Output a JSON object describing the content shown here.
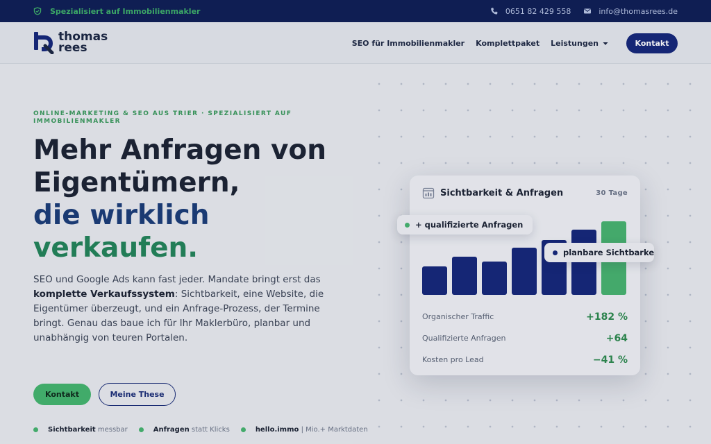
{
  "topbar": {
    "tagline": "Spezialisiert auf Immobilienmakler",
    "phone": "0651 82 429 558",
    "email": "info@thomasrees.de",
    "icons": {
      "left": "shield-check-icon",
      "phone": "phone-icon",
      "email": "mail-icon"
    }
  },
  "header": {
    "logo": {
      "line1": "thomas",
      "line2": "rees"
    },
    "nav": [
      {
        "label": "SEO für Immobilienmakler"
      },
      {
        "label": "Komplettpaket"
      },
      {
        "label": "Leistungen",
        "has_dropdown": true
      }
    ],
    "cta": "Kontakt"
  },
  "hero": {
    "kicker": "Online-Marketing & SEO aus Trier · Spezialisiert auf Immobilienmakler",
    "headline_1": "Mehr Anfragen von Eigentümern,",
    "headline_2": "die wirklich",
    "headline_3": "verkaufen.",
    "intro_1": "SEO und Google Ads kann fast jeder. Mandate bringt erst das",
    "intro_bold": "komplette Verkaufssystem",
    "intro_2": ": Sichtbarkeit, eine Website, die Eigentümer überzeugt, und ein Anfrage-Prozess, der Termine bringt. Genau das baue ich für Ihr Maklerbüro, planbar und unabhängig von teuren Portalen.",
    "primary_button": "Kontakt",
    "secondary_button": "Meine These",
    "features": [
      {
        "bold": "Sichtbarkeit",
        "rest": "messbar"
      },
      {
        "bold": "Anfragen",
        "rest": "statt Klicks"
      },
      {
        "bold": "hello.immo",
        "rest": "| Mio.+ Marktdaten"
      }
    ]
  },
  "card": {
    "title": "Sichtbarkeit & Anfragen",
    "period": "30 Tage",
    "icon": "calendar-chart-icon",
    "bars": [
      {
        "value": 0.37,
        "highlight": false
      },
      {
        "value": 0.5,
        "highlight": false
      },
      {
        "value": 0.44,
        "highlight": false
      },
      {
        "value": 0.62,
        "highlight": false
      },
      {
        "value": 0.72,
        "highlight": false
      },
      {
        "value": 0.85,
        "highlight": false
      },
      {
        "value": 0.96,
        "highlight": true
      }
    ],
    "stats": [
      {
        "label": "Organischer Traffic",
        "value": "+182 %"
      },
      {
        "label": "Qualifizierte Anfragen",
        "value": "+64"
      },
      {
        "label": "Kosten pro Lead",
        "value": "−41 %"
      }
    ],
    "pill_1": "+ qualifizierte Anfragen",
    "pill_2": "planbare Sichtbarkeit",
    "colors": {
      "accent_blue": "#16287a",
      "accent_green": "#48b36f"
    }
  }
}
